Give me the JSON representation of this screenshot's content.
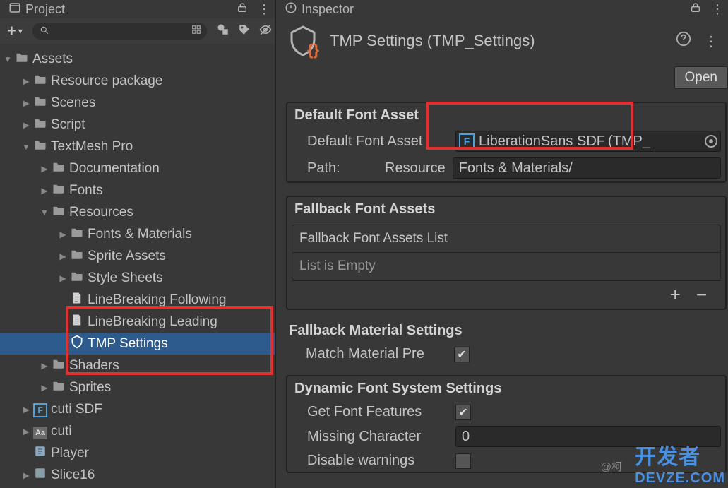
{
  "project": {
    "tab_title": "Project",
    "tree": {
      "root": "Assets",
      "items": [
        "Resource package",
        "Scenes",
        "Script",
        "TextMesh Pro",
        "Documentation",
        "Fonts",
        "Resources",
        "Fonts & Materials",
        "Sprite Assets",
        "Style Sheets",
        "LineBreaking Following",
        "LineBreaking Leading",
        "TMP Settings",
        "Shaders",
        "Sprites",
        "cuti SDF",
        "cuti",
        "Player",
        "Slice16"
      ]
    }
  },
  "inspector": {
    "tab_title": "Inspector",
    "title": "TMP Settings (TMP_Settings)",
    "open_btn": "Open",
    "sections": {
      "default_font": {
        "heading": "Default Font Asset",
        "asset_label": "Default Font Asset",
        "asset_value": "LiberationSans SDF",
        "asset_suffix": "(TMP_",
        "path_label": "Path:",
        "path_prefix": "Resource",
        "path_value": "Fonts & Materials/"
      },
      "fallback": {
        "heading": "Fallback Font Assets",
        "list_head": "Fallback Font Assets List",
        "list_empty": "List is Empty"
      },
      "fallback_mat": {
        "heading": "Fallback Material Settings",
        "match_label": "Match Material Pre"
      },
      "dynamic": {
        "heading": "Dynamic Font System Settings",
        "get_features": "Get Font Features",
        "missing_char_label": "Missing Character",
        "missing_char_value": "0",
        "disable_warnings": "Disable warnings"
      }
    }
  },
  "watermark": {
    "l1": "开发者",
    "l2": "DEVZE.COM"
  },
  "credit": "@柯"
}
